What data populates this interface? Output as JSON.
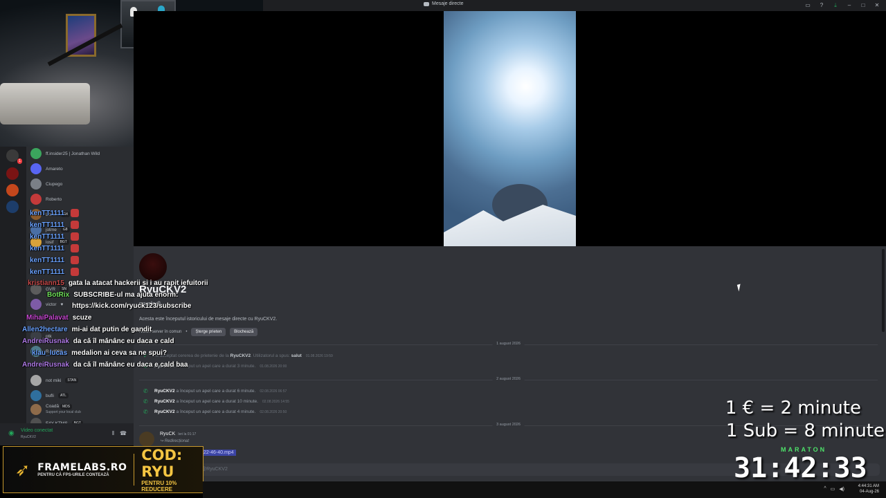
{
  "window": {
    "title": "Mesaje directe"
  },
  "dm": {
    "name": "RyuCKV2",
    "handle": "ryuckv2",
    "intro": "Acesta este începutul istoricului de mesaje directe cu RyuCKV2.",
    "common": "Niciun server în comun",
    "remove_friend": "Șterge prieten",
    "block": "Blochează",
    "date1": "1 august 2026",
    "date2": "2 august 2026",
    "date3": "3 august 2026",
    "req_prefix": "Ai acceptat cererea de prietenie de la",
    "req_user": "RyuCKV2",
    "req_mid": ". Utilizatorul a spus:",
    "req_word": "salut",
    "req_ts": "01.08.2026 19:59",
    "call1_user": "RyuCKV2",
    "call1_text": "a început un apel care a durat 3 minute.",
    "call1_ts": "01.08.2026 20:00",
    "call2_user": "RyuCKV2",
    "call2_text": "a început un apel care a durat 6 minute.",
    "call2_ts": "02.08.2026 06:57",
    "call3_user": "RyuCKV2",
    "call3_text": "a început un apel care a durat 10 minute.",
    "call3_ts": "02.08.2026 14:55",
    "call4_user": "RyuCKV2",
    "call4_text": "a început un apel care a durat 4 minute.",
    "call4_ts": "02.08.2026 20:50",
    "last_user": "RyuCK",
    "last_ts": "Ieri la 01:17",
    "forwarded": "Redirecționat",
    "file": "22-46-40.mp4",
    "composer_placeholder": "@RyuCKV2"
  },
  "members": [
    {
      "name": "ff.insider25 | Jonathan Wild",
      "color": "#3ba55d"
    },
    {
      "name": "Amareto",
      "color": "#5865f2"
    },
    {
      "name": "Ciupego",
      "color": "#7a7f87"
    },
    {
      "name": "Roberto",
      "color": "#c43a3a"
    },
    {
      "name": "Lorco",
      "tag": "G4",
      "color": "#8a5a2c"
    },
    {
      "name": "jotme",
      "tag": "G8",
      "color": "#4a6fa5"
    },
    {
      "name": "losif",
      "tag": "BGT",
      "color": "#d8a23a"
    },
    {
      "name": "GVR",
      "tag": "SN",
      "color": "#5c5c5c"
    },
    {
      "name": "victor",
      "tag": "♥",
      "color": "#7d5ba6"
    },
    {
      "name": "ptk",
      "color": "#3b3f45"
    },
    {
      "name": "Raul988",
      "color": "#4d7a8a"
    },
    {
      "name": "not miki",
      "tag": "STAN",
      "color": "#a6a6a6"
    },
    {
      "name": "bufli",
      "tag": "ATL",
      "color": "#2f6f9e"
    },
    {
      "name": "Coadă",
      "tag": "MDS",
      "sub": "Support your local club",
      "color": "#8e6b4a"
    },
    {
      "name": "F4Y KTMS",
      "tag": "BGT",
      "color": "#505050"
    }
  ],
  "voice": {
    "status": "Video conectat",
    "channel": "RyuCKV2"
  },
  "servers": [
    {
      "color": "#3a3a3a",
      "badge": "1"
    },
    {
      "color": "#7a1414",
      "badge": ""
    },
    {
      "color": "#c4471c",
      "badge": ""
    },
    {
      "color": "#1d3d6a",
      "badge": ""
    }
  ],
  "chat": [
    {
      "user": "kenTT1111",
      "msg": "",
      "color": "#6aa2ff"
    },
    {
      "user": "kenTT1111",
      "msg": "",
      "color": "#6aa2ff"
    },
    {
      "user": "kenTT1111",
      "msg": "",
      "color": "#6aa2ff"
    },
    {
      "user": "kenTT1111",
      "msg": "",
      "color": "#6aa2ff"
    },
    {
      "user": "kenTT1111",
      "msg": "",
      "color": "#6aa2ff"
    },
    {
      "user": "kenTT1111",
      "msg": "",
      "color": "#6aa2ff"
    },
    {
      "user": "kristiann15",
      "msg": "gata la atacat hackerii si i au rapit iefuitorii",
      "color": "#c94a4a"
    },
    {
      "user": "BotRix",
      "msg": "SUBSCRIBE-ul ma ajuta enorm:",
      "color": "#6fe05a"
    },
    {
      "user": "",
      "msg": "https://kick.com/ryuck123/subscribe",
      "color": "#ffffff"
    },
    {
      "user": "MihaiPalavat",
      "msg": "scuze",
      "color": "#c94ad4"
    },
    {
      "user": "Allen2hectare",
      "msg": "mi-ai dat putin de gandit",
      "color": "#6aa2ff"
    },
    {
      "user": "AndreiRusnak",
      "msg": "da că îl mănânc eu daca e cald",
      "color": "#b07be8"
    },
    {
      "user": "klau_lucas",
      "msg": "medalion ai ceva sa ne spui?",
      "color": "#6aa2ff"
    },
    {
      "user": "AndreiRusnak",
      "msg": "da că îl mănânc eu daca e cald baa",
      "color": "#b07be8"
    }
  ],
  "sponsor": {
    "brand": "FRAMELABS.RO",
    "tagline": "PENTRU CĂ FPS-URILE CONTEAZĂ",
    "code": "COD: RYU",
    "discount": "PENTRU 10% REDUCERE"
  },
  "overlay": {
    "rate1": "1 € = 2 minute",
    "rate2": "1 Sub = 8 minute",
    "label": "MARATON",
    "timer": "31:42:33"
  },
  "taskbar": {
    "time": "4:44:31 AM",
    "date": "04-Aug-26"
  }
}
